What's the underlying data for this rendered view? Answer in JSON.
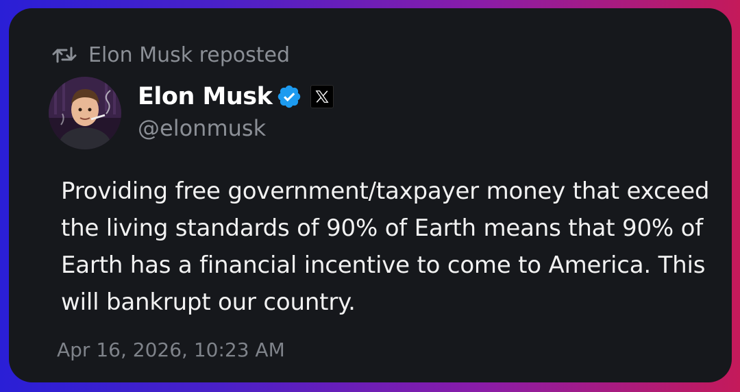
{
  "repost": {
    "text": "Elon Musk reposted",
    "icon": "repost-icon"
  },
  "author": {
    "name": "Elon Musk",
    "handle": "@elonmusk",
    "verified_icon": "verified-badge-icon",
    "verified_color": "#1d9bf0",
    "platform_icon": "x-logo-icon",
    "platform_glyph": "𝕏"
  },
  "post": {
    "text": "Providing free government/taxpayer money that exceed the living standards of 90% of Earth means that 90% of Earth has a financial incentive to come to America. This will bankrupt our country.",
    "timestamp": "Apr 16, 2026, 10:23 AM"
  },
  "colors": {
    "card_background": "#16181c",
    "gradient_left": "#2a1fd6",
    "gradient_right": "#c41a5a",
    "secondary_text": "#8b8f96"
  }
}
